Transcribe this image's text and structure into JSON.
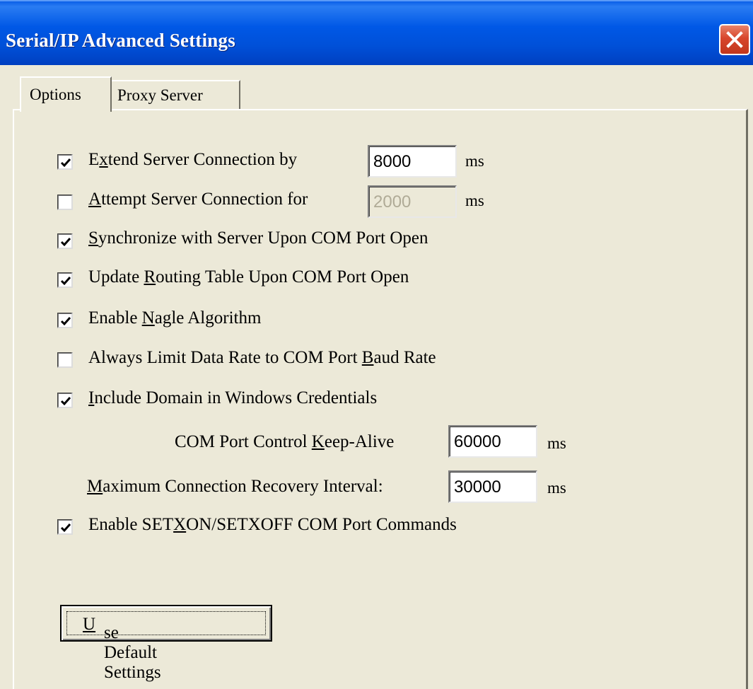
{
  "window": {
    "title": "Serial/IP Advanced Settings",
    "close_icon": "close-icon"
  },
  "tabs": [
    {
      "label": "Options",
      "selected": true
    },
    {
      "label": "Proxy Server",
      "selected": false
    }
  ],
  "options": {
    "extend": {
      "pre": "E",
      "u": "x",
      "post": "tend Server Connection by",
      "checked": true,
      "value": "8000",
      "unit": "ms"
    },
    "attempt": {
      "pre": "",
      "u": "A",
      "post": "ttempt Server Connection for",
      "checked": false,
      "value": "2000",
      "unit": "ms",
      "disabled": true
    },
    "sync": {
      "pre": "",
      "u": "S",
      "post": "ynchronize with Server Upon COM Port Open",
      "checked": true
    },
    "routing": {
      "pre": "Update ",
      "u": "R",
      "post": "outing Table Upon COM Port Open",
      "checked": true
    },
    "nagle": {
      "pre": "Enable ",
      "u": "N",
      "post": "agle Algorithm",
      "checked": true
    },
    "limit": {
      "pre": "Always Limit Data Rate to COM Port ",
      "u": "B",
      "post": "aud Rate",
      "checked": false
    },
    "domain": {
      "pre": "",
      "u": "I",
      "post": "nclude Domain in Windows Credentials",
      "checked": true
    },
    "keepalive": {
      "pre": "COM Port Control ",
      "u": "K",
      "post": "eep-Alive",
      "value": "60000",
      "unit": "ms"
    },
    "recovery": {
      "pre": "",
      "u": "M",
      "post": "aximum Connection Recovery Interval:",
      "value": "30000",
      "unit": "ms"
    },
    "setxon": {
      "pre": "Enable SET",
      "u": "X",
      "post": "ON/SETXOFF COM Port Commands",
      "checked": true
    }
  },
  "buttons": {
    "defaults": {
      "pre": "",
      "u": "U",
      "post": "se Default Settings"
    }
  }
}
